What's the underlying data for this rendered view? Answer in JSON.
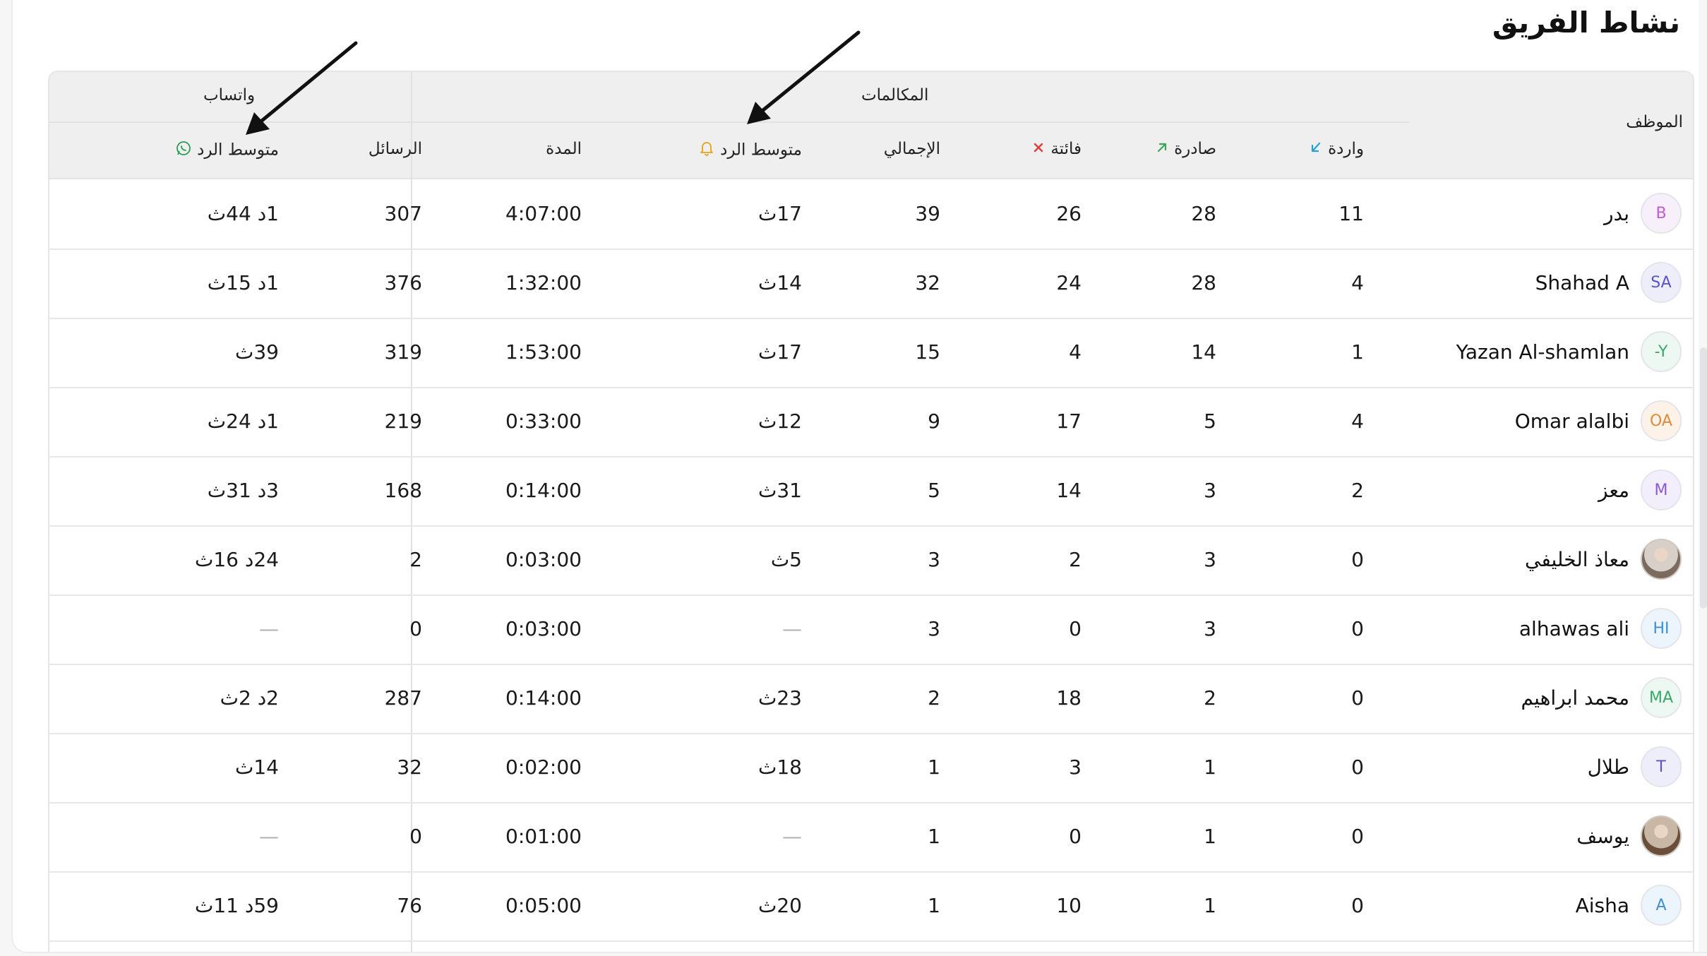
{
  "page_title": "نشاط الفريق",
  "headers": {
    "employee": "الموظف",
    "calls_group": "المكالمات",
    "whatsapp_group": "واتساب",
    "incoming": "واردة",
    "outgoing": "صادرة",
    "missed": "فائتة",
    "total": "الإجمالي",
    "call_avg_response": "متوسط الرد",
    "duration": "المدة",
    "messages": "الرسائل",
    "wa_avg_response": "متوسط الرد"
  },
  "colors": {
    "incoming_icon": "#2a9fd6",
    "outgoing_icon": "#3aa655",
    "missed_icon": "#e23b3b",
    "bell_icon": "#e5a31a",
    "whatsapp_icon": "#2f9b5a"
  },
  "rows": [
    {
      "initials": "B",
      "avatar_color": "#c25bd6",
      "avatar_bg": "#f7effa",
      "photo": false,
      "name": "بدر",
      "incoming": "11",
      "outgoing": "28",
      "missed": "26",
      "total": "39",
      "call_avg": "17ث",
      "duration": "4:07:00",
      "messages": "307",
      "wa_avg": "1د 44ث"
    },
    {
      "initials": "SA",
      "avatar_color": "#5a54c8",
      "avatar_bg": "#eeeefb",
      "photo": false,
      "name": "Shahad A",
      "incoming": "4",
      "outgoing": "28",
      "missed": "24",
      "total": "32",
      "call_avg": "14ث",
      "duration": "1:32:00",
      "messages": "376",
      "wa_avg": "1د 15ث"
    },
    {
      "initials": "-Y",
      "avatar_color": "#3aa86b",
      "avatar_bg": "#eef8f2",
      "photo": false,
      "name": "Yazan Al-shamlan",
      "incoming": "1",
      "outgoing": "14",
      "missed": "4",
      "total": "15",
      "call_avg": "17ث",
      "duration": "1:53:00",
      "messages": "319",
      "wa_avg": "39ث"
    },
    {
      "initials": "OA",
      "avatar_color": "#e08a3c",
      "avatar_bg": "#fdf2e8",
      "photo": false,
      "name": "Omar alalbi",
      "incoming": "4",
      "outgoing": "5",
      "missed": "17",
      "total": "9",
      "call_avg": "12ث",
      "duration": "0:33:00",
      "messages": "219",
      "wa_avg": "1د 24ث"
    },
    {
      "initials": "M",
      "avatar_color": "#8a5bd0",
      "avatar_bg": "#f3eefb",
      "photo": false,
      "name": "معز",
      "incoming": "2",
      "outgoing": "3",
      "missed": "14",
      "total": "5",
      "call_avg": "31ث",
      "duration": "0:14:00",
      "messages": "168",
      "wa_avg": "3د 31ث"
    },
    {
      "initials": "",
      "avatar_color": "#7b6a5e",
      "avatar_bg": "#d8d0c8",
      "photo": true,
      "name": "معاذ الخليفي",
      "incoming": "0",
      "outgoing": "3",
      "missed": "2",
      "total": "3",
      "call_avg": "5ث",
      "duration": "0:03:00",
      "messages": "2",
      "wa_avg": "24د 16ث"
    },
    {
      "initials": "HI",
      "avatar_color": "#3d8fd6",
      "avatar_bg": "#edf5fc",
      "photo": false,
      "name": "alhawas ali",
      "incoming": "0",
      "outgoing": "3",
      "missed": "0",
      "total": "3",
      "call_avg": "—",
      "duration": "0:03:00",
      "messages": "0",
      "wa_avg": "—"
    },
    {
      "initials": "MA",
      "avatar_color": "#3aa86b",
      "avatar_bg": "#eef8f2",
      "photo": false,
      "name": "محمد ابراهيم",
      "incoming": "0",
      "outgoing": "2",
      "missed": "18",
      "total": "2",
      "call_avg": "23ث",
      "duration": "0:14:00",
      "messages": "287",
      "wa_avg": "2د 2ث"
    },
    {
      "initials": "T",
      "avatar_color": "#5a54c8",
      "avatar_bg": "#eeeefb",
      "photo": false,
      "name": "طلال",
      "incoming": "0",
      "outgoing": "1",
      "missed": "3",
      "total": "1",
      "call_avg": "18ث",
      "duration": "0:02:00",
      "messages": "32",
      "wa_avg": "14ث"
    },
    {
      "initials": "",
      "avatar_color": "#6b4e3a",
      "avatar_bg": "#c9b7a6",
      "photo": true,
      "name": "يوسف",
      "incoming": "0",
      "outgoing": "1",
      "missed": "0",
      "total": "1",
      "call_avg": "—",
      "duration": "0:01:00",
      "messages": "0",
      "wa_avg": "—"
    },
    {
      "initials": "A",
      "avatar_color": "#3d8fd6",
      "avatar_bg": "#edf5fc",
      "photo": false,
      "name": "Aisha",
      "incoming": "0",
      "outgoing": "1",
      "missed": "10",
      "total": "1",
      "call_avg": "20ث",
      "duration": "0:05:00",
      "messages": "76",
      "wa_avg": "59د 11ث"
    }
  ]
}
